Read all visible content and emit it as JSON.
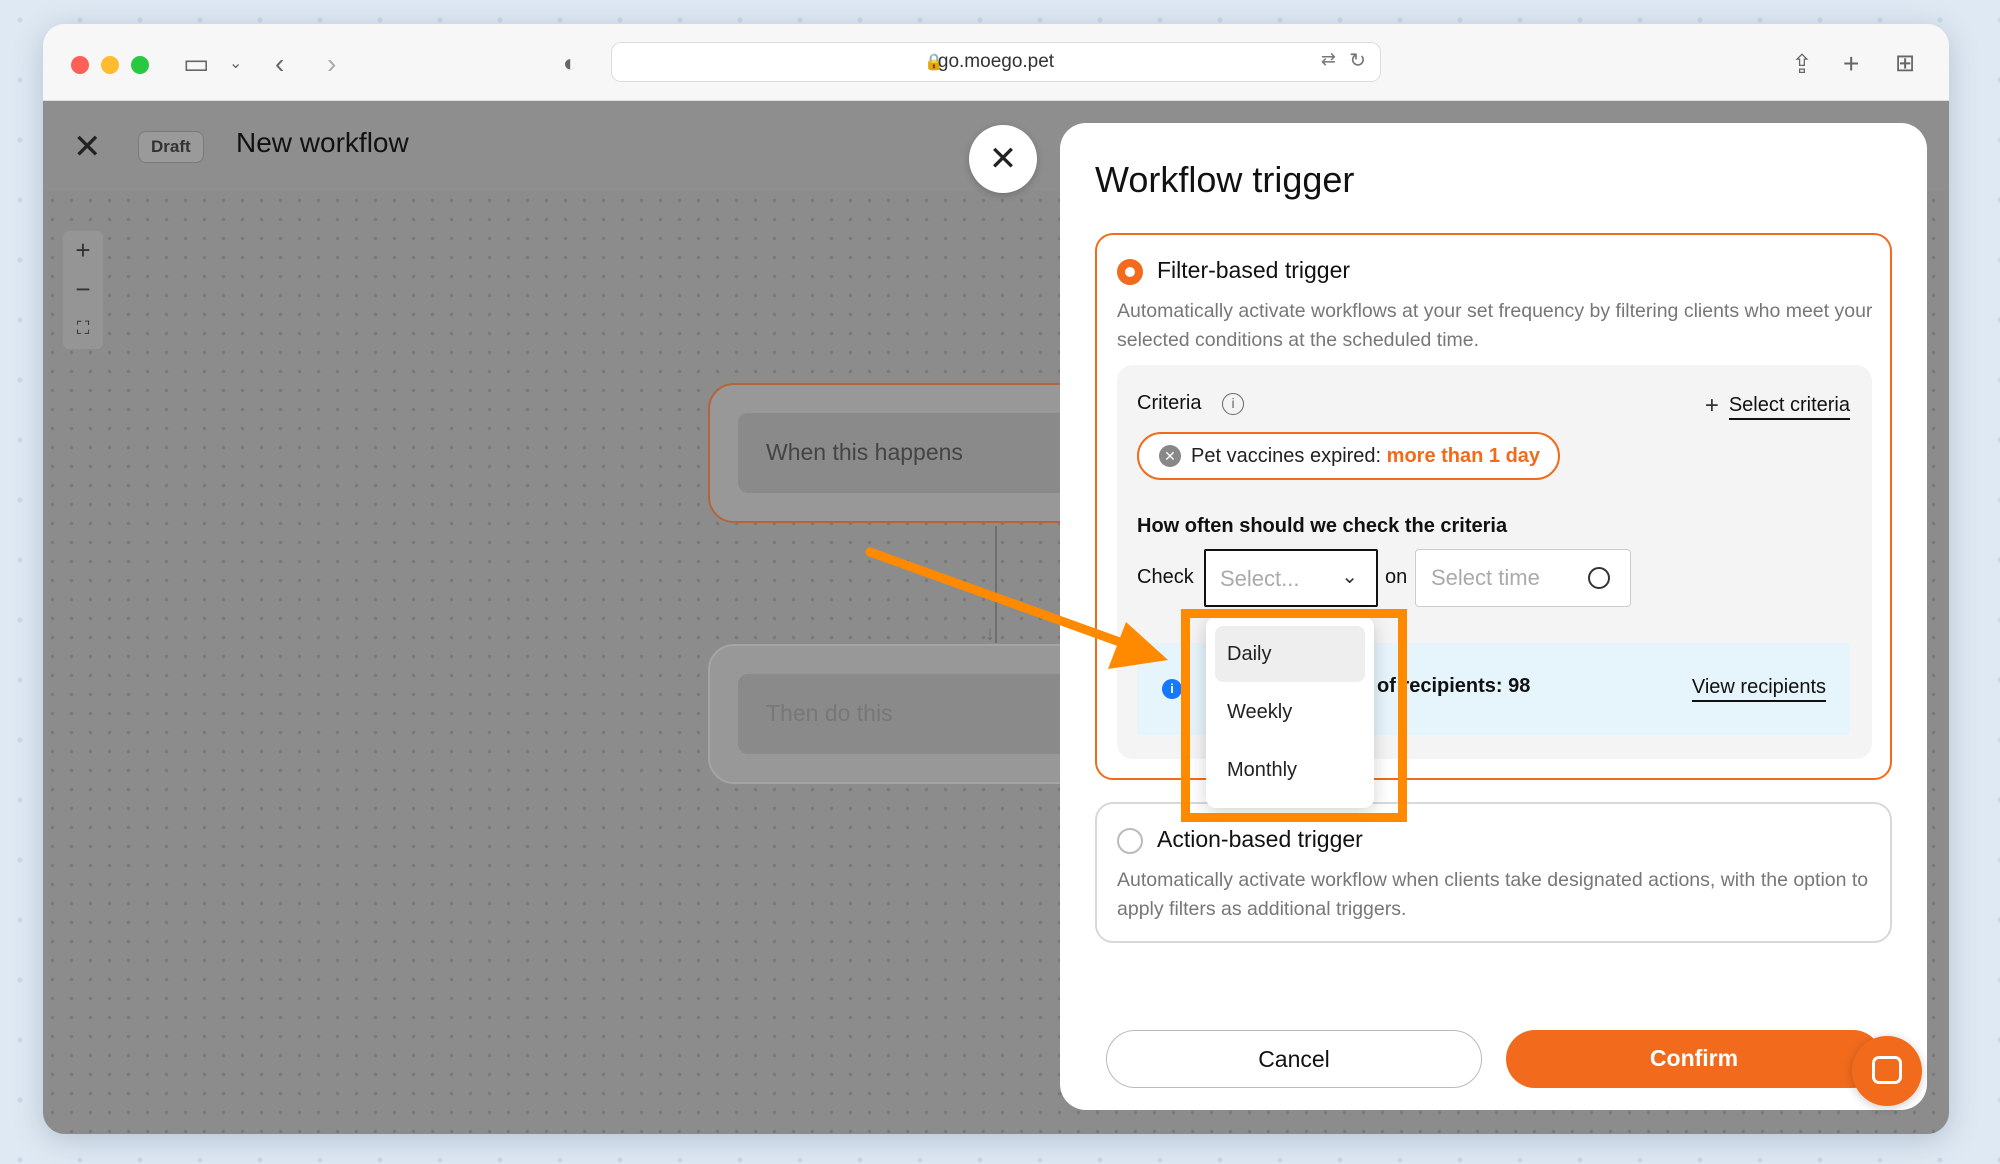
{
  "browser": {
    "url": "go.moego.pet"
  },
  "header": {
    "draft_badge": "Draft",
    "title": "New workflow"
  },
  "zoom": {
    "plus": "+",
    "minus": "−",
    "fit": "⛶"
  },
  "canvas": {
    "node1_label": "When this happens",
    "node2_label": "Then do this"
  },
  "drawer": {
    "title": "Workflow trigger",
    "filter": {
      "title": "Filter-based trigger",
      "description": "Automatically activate workflows at your set frequency by filtering clients who meet your selected conditions at the scheduled time.",
      "criteria_label": "Criteria",
      "select_criteria": "Select criteria",
      "chip_label": "Pet vaccines expired:",
      "chip_value": "more than 1 day",
      "frequency_label": "How often should we check the criteria",
      "check_label": "Check",
      "check_placeholder": "Select...",
      "on_label": "on",
      "time_placeholder": "Select time",
      "recipients_text": "of recipients: 98",
      "view_recipients": "View recipients"
    },
    "action": {
      "title": "Action-based trigger",
      "description": "Automatically activate workflow when clients take designated actions, with the option to apply filters as additional triggers."
    },
    "cancel": "Cancel",
    "confirm": "Confirm"
  },
  "dropdown": {
    "options": [
      "Daily",
      "Weekly",
      "Monthly"
    ],
    "hovered": "Daily"
  },
  "colors": {
    "accent": "#f26b1d",
    "annotation": "#ff8a00",
    "info": "#1677ff"
  }
}
